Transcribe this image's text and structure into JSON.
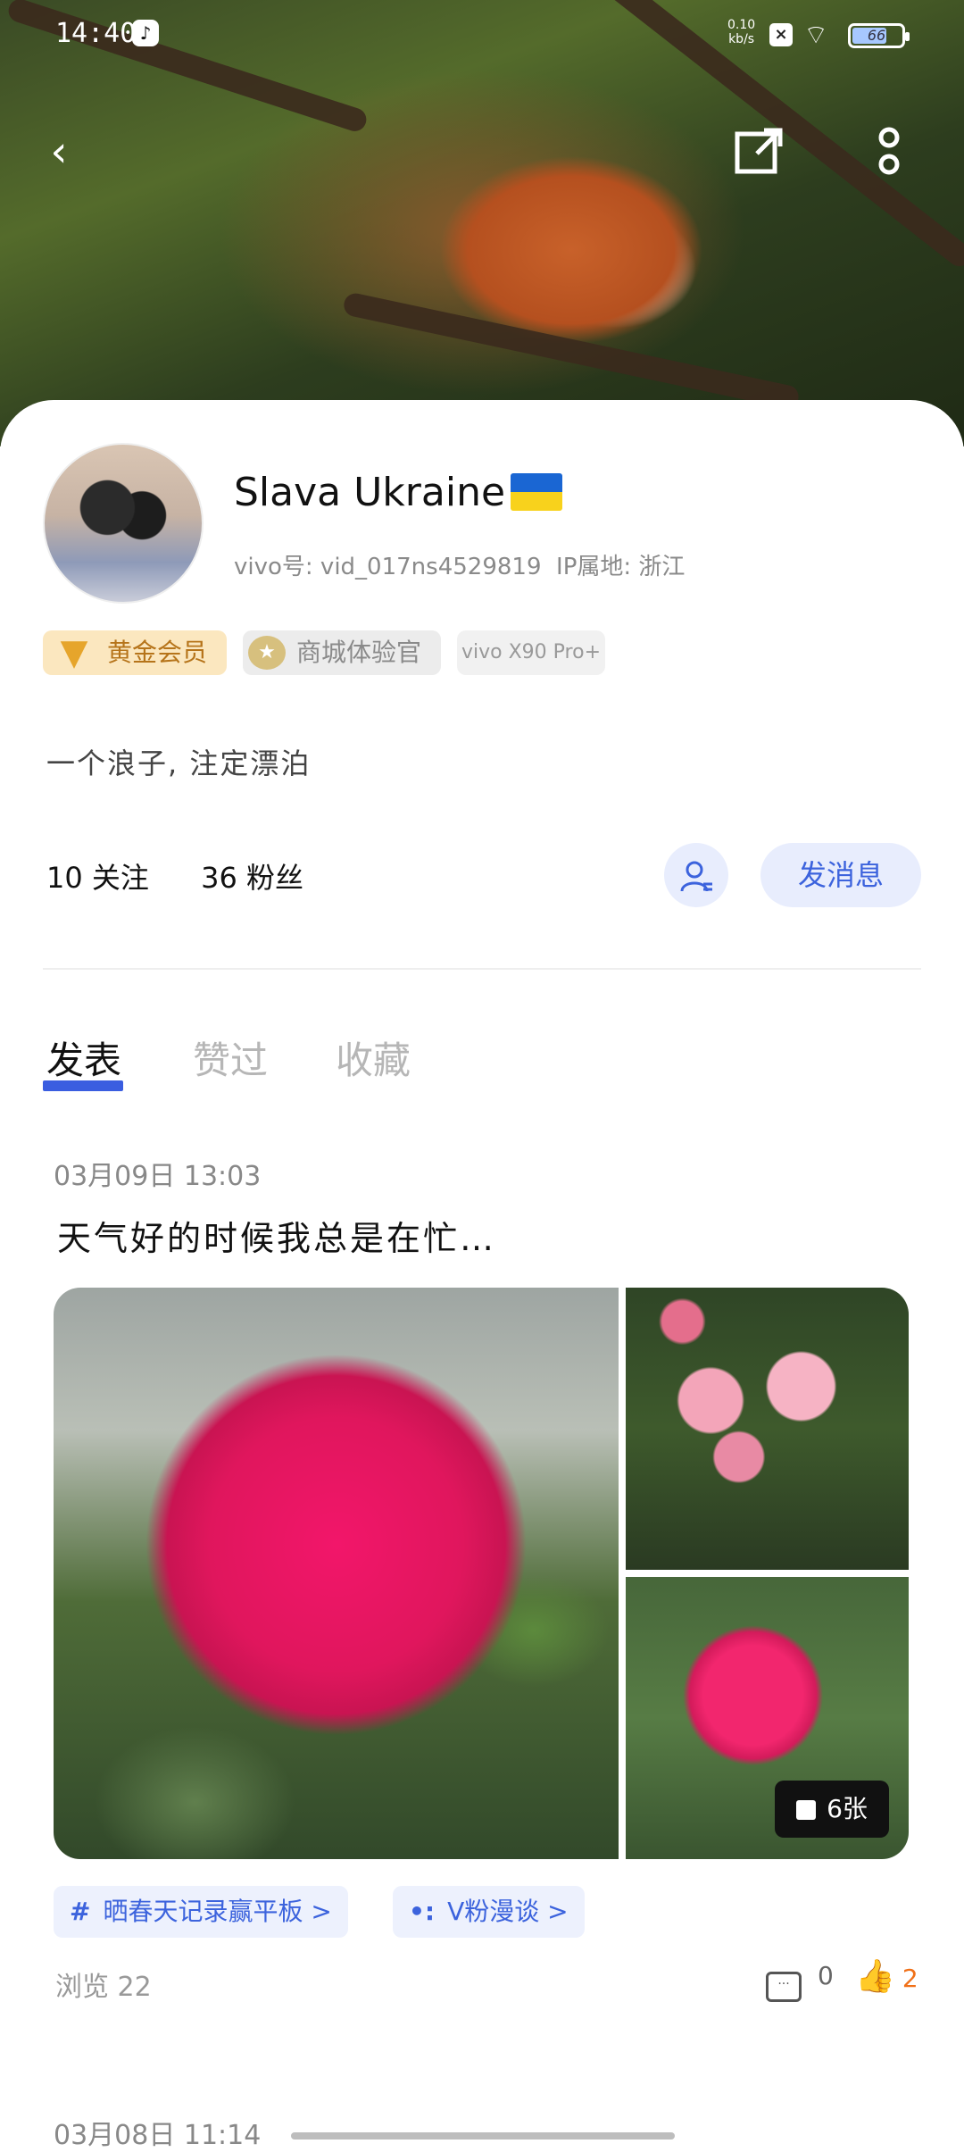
{
  "status_bar": {
    "time": "14:40",
    "app_icon": "tiktok-icon",
    "net_speed_value": "0.10",
    "net_speed_unit": "kb/s",
    "battery": "66"
  },
  "header": {
    "back_icon": "back-arrow-icon",
    "share_icon": "share-icon",
    "more_icon": "more-vertical-icon"
  },
  "profile": {
    "username": "Slava Ukraine",
    "vivo_id": "vivo号: vid_017ns4529819",
    "ip_location": "IP属地: 浙江",
    "badges": {
      "gold": "黄金会员",
      "mall": "商城体验官",
      "device": "vivo X90 Pro+"
    },
    "bio": "一个浪子, 注定漂泊",
    "following": "10 关注",
    "followers": "36 粉丝",
    "message_button": "发消息"
  },
  "tabs": [
    {
      "label": "发表",
      "active": true
    },
    {
      "label": "赞过",
      "active": false
    },
    {
      "label": "收藏",
      "active": false
    }
  ],
  "post": {
    "date": "03月09日 13:03",
    "title": "天气好的时候我总是在忙…",
    "image_count_label": "6张",
    "topics": [
      {
        "icon": "#",
        "label": "晒春天记录赢平板 >"
      },
      {
        "icon": "•:",
        "label": "V粉漫谈 >"
      }
    ],
    "views": "浏览 22",
    "comments": "0",
    "likes": "2"
  },
  "next_post": {
    "date": "03月08日 11:14"
  },
  "colors": {
    "accent": "#3c63dd",
    "like": "#f07018",
    "gold_badge_bg": "#fbe7bf"
  }
}
